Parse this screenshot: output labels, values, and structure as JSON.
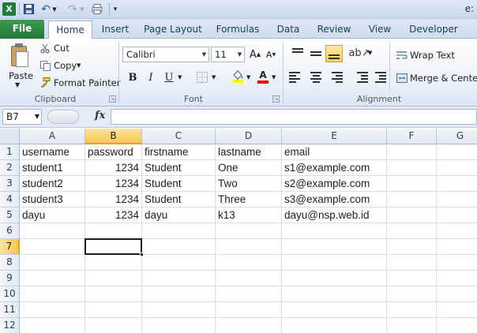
{
  "window": {
    "title_fragment": "e:"
  },
  "tabs": [
    {
      "label": "File"
    },
    {
      "label": "Home"
    },
    {
      "label": "Insert"
    },
    {
      "label": "Page Layout"
    },
    {
      "label": "Formulas"
    },
    {
      "label": "Data"
    },
    {
      "label": "Review"
    },
    {
      "label": "View"
    },
    {
      "label": "Developer"
    }
  ],
  "ribbon": {
    "clipboard": {
      "paste": "Paste",
      "cut": "Cut",
      "copy": "Copy",
      "format_painter": "Format Painter",
      "label": "Clipboard"
    },
    "font": {
      "name": "Calibri",
      "size": "11",
      "label": "Font",
      "bold": "B",
      "italic": "I",
      "underline": "U",
      "fill_color": "#ffff00",
      "font_color": "#ff0000"
    },
    "alignment": {
      "wrap_text": "Wrap Text",
      "merge_center": "Merge & Center",
      "label": "Alignment"
    }
  },
  "formula_bar": {
    "name_box": "B7",
    "fx": "fx",
    "content": ""
  },
  "sheet": {
    "columns": [
      "A",
      "B",
      "C",
      "D",
      "E",
      "F",
      "G"
    ],
    "selected_column": "B",
    "selected_row": "7",
    "rows": [
      {
        "num": "1",
        "cells": [
          "username",
          "password",
          "firstname",
          "lastname",
          "email",
          "",
          ""
        ]
      },
      {
        "num": "2",
        "cells": [
          "student1",
          "1234",
          "Student",
          "One",
          "s1@example.com",
          "",
          ""
        ]
      },
      {
        "num": "3",
        "cells": [
          "student2",
          "1234",
          "Student",
          "Two",
          "s2@example.com",
          "",
          ""
        ]
      },
      {
        "num": "4",
        "cells": [
          "student3",
          "1234",
          "Student",
          "Three",
          "s3@example.com",
          "",
          ""
        ]
      },
      {
        "num": "5",
        "cells": [
          "dayu",
          "1234",
          "dayu",
          "k13",
          "dayu@nsp.web.id",
          "",
          ""
        ]
      },
      {
        "num": "6",
        "cells": [
          "",
          "",
          "",
          "",
          "",
          "",
          ""
        ]
      },
      {
        "num": "7",
        "cells": [
          "",
          "",
          "",
          "",
          "",
          "",
          ""
        ]
      },
      {
        "num": "8",
        "cells": [
          "",
          "",
          "",
          "",
          "",
          "",
          ""
        ]
      },
      {
        "num": "9",
        "cells": [
          "",
          "",
          "",
          "",
          "",
          "",
          ""
        ]
      },
      {
        "num": "10",
        "cells": [
          "",
          "",
          "",
          "",
          "",
          "",
          ""
        ]
      },
      {
        "num": "11",
        "cells": [
          "",
          "",
          "",
          "",
          "",
          "",
          ""
        ]
      },
      {
        "num": "12",
        "cells": [
          "",
          "",
          "",
          "",
          "",
          "",
          ""
        ]
      }
    ]
  }
}
